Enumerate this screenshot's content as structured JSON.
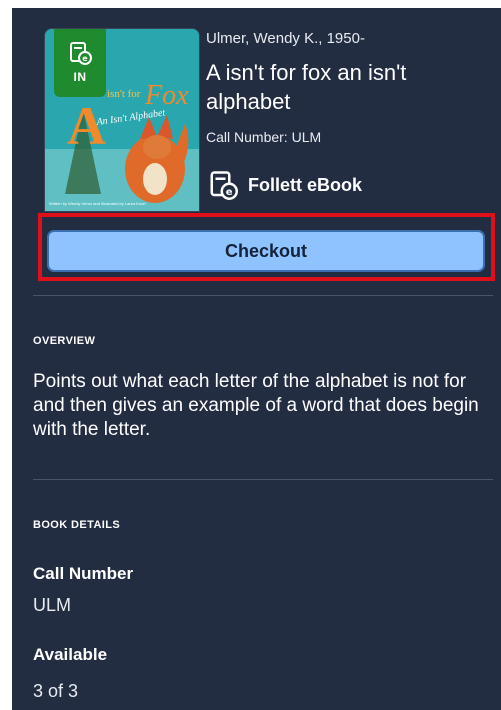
{
  "book": {
    "author": "Ulmer, Wendy K., 1950-",
    "title": "A isn't for fox an isn't alphabet",
    "call_number_line": "Call Number: ULM",
    "availability_badge": "IN",
    "format": "Follett eBook",
    "cover_text": {
      "title_a": "A",
      "title_isnt_for": "isn't for",
      "title_fox": "Fox",
      "title_subtitle": "An Isn't Alphabet",
      "credits": "Written by Wendy Ulmer and Illustrated by Laura Knorr"
    }
  },
  "actions": {
    "checkout_label": "Checkout"
  },
  "overview": {
    "heading": "OVERVIEW",
    "text": "Points out what each letter of the alphabet is not for and then gives an example of a word that does begin with the letter."
  },
  "details": {
    "heading": "BOOK DETAILS",
    "call_number_label": "Call Number",
    "call_number_value": "ULM",
    "available_label": "Available",
    "available_value": "3 of 3"
  },
  "colors": {
    "panel_bg": "#232d42",
    "badge_green": "#1f8a2e",
    "checkout_bg": "#8ec3ff",
    "highlight_red": "#e0101a"
  }
}
